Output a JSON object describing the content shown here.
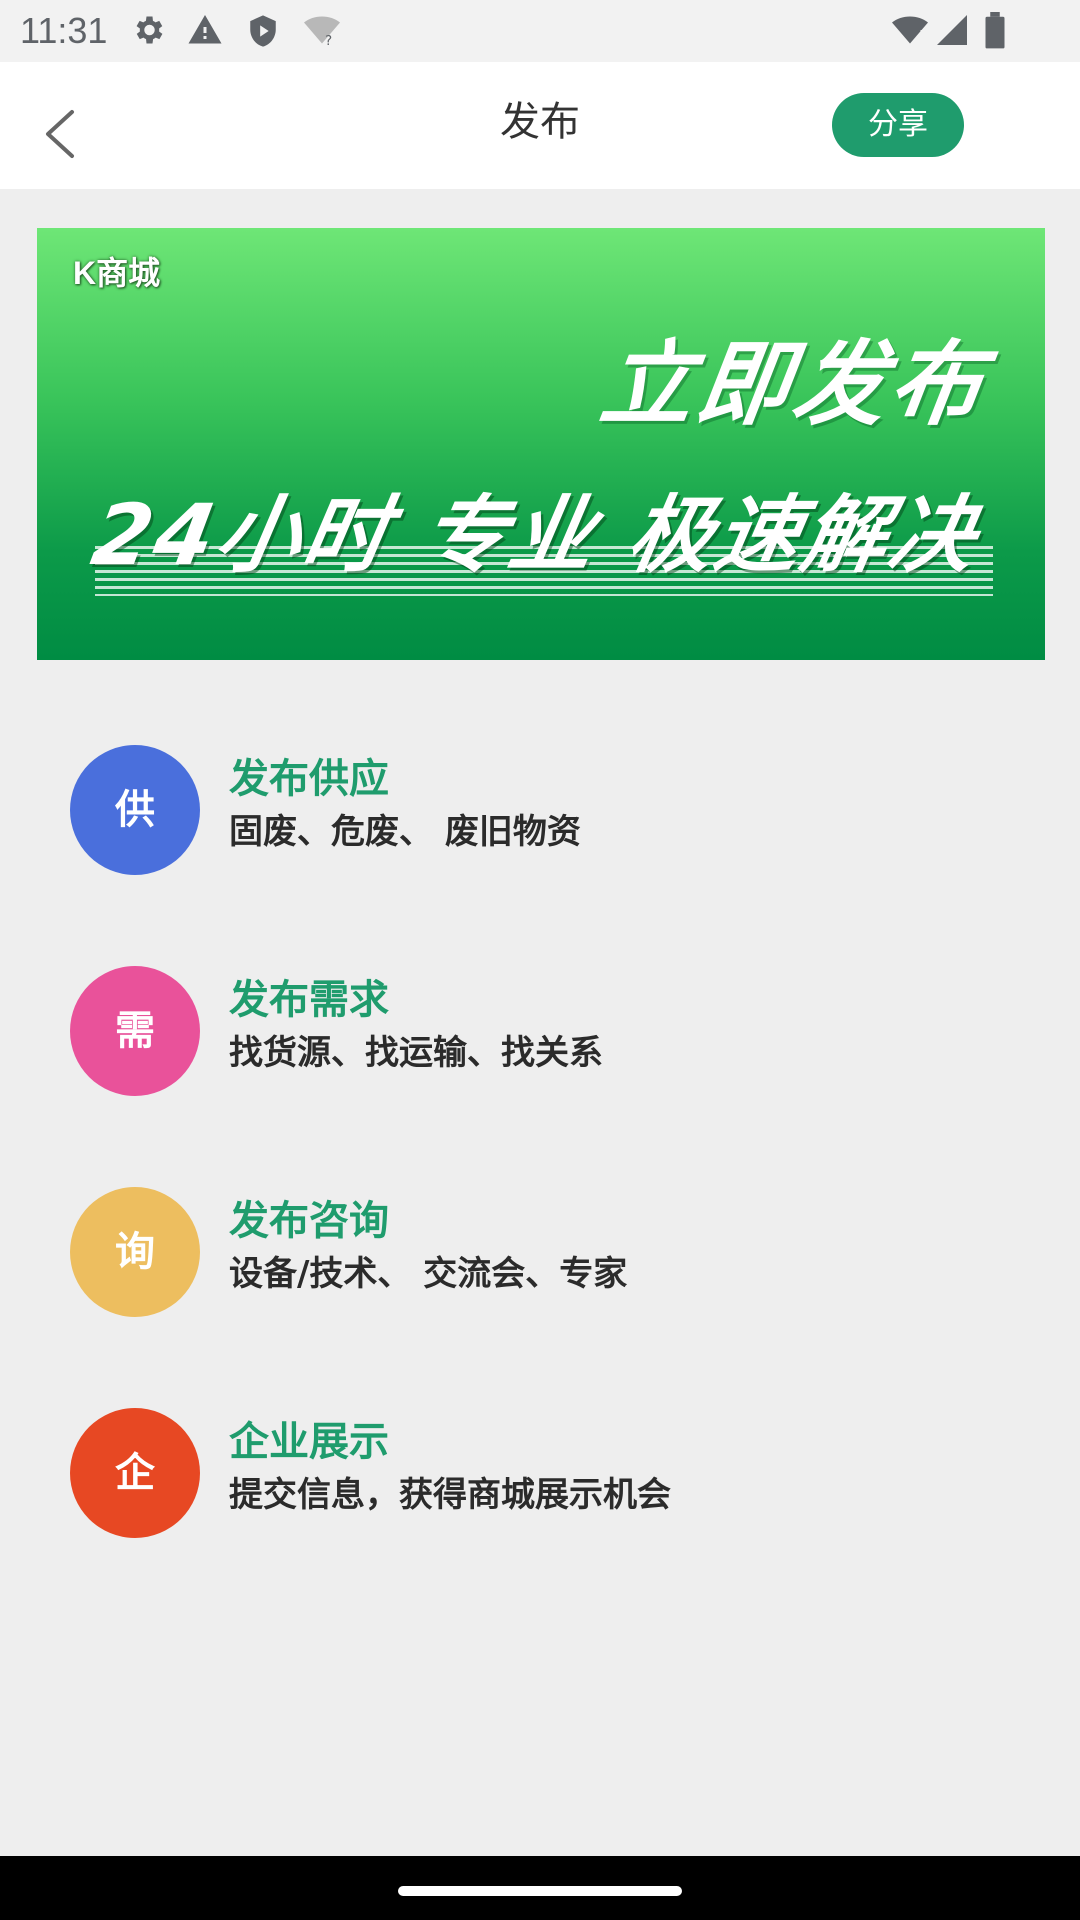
{
  "status_bar": {
    "time": "11:31",
    "icons_left": [
      "gear-icon",
      "warning-icon",
      "shield-icon",
      "wifi-question-icon"
    ],
    "icons_right": [
      "wifi-icon",
      "signal-icon",
      "battery-icon"
    ]
  },
  "header": {
    "title": "发布",
    "share_label": "分享",
    "accent_color": "#1f9c6d"
  },
  "banner": {
    "brand": "K商城",
    "headline": "立即发布",
    "subline": "24小时 专业 极速解决"
  },
  "menu": {
    "items": [
      {
        "badge": "供",
        "title": "发布供应",
        "desc": "固废、危废、 废旧物资",
        "color": "#4a6fdc"
      },
      {
        "badge": "需",
        "title": "发布需求",
        "desc": "找货源、找运输、找关系",
        "color": "#e9529a"
      },
      {
        "badge": "询",
        "title": "发布咨询",
        "desc": "设备/技术、 交流会、专家",
        "color": "#edbe5f"
      },
      {
        "badge": "企",
        "title": "企业展示",
        "desc": "提交信息，获得商城展示机会",
        "color": "#e74823"
      }
    ]
  }
}
